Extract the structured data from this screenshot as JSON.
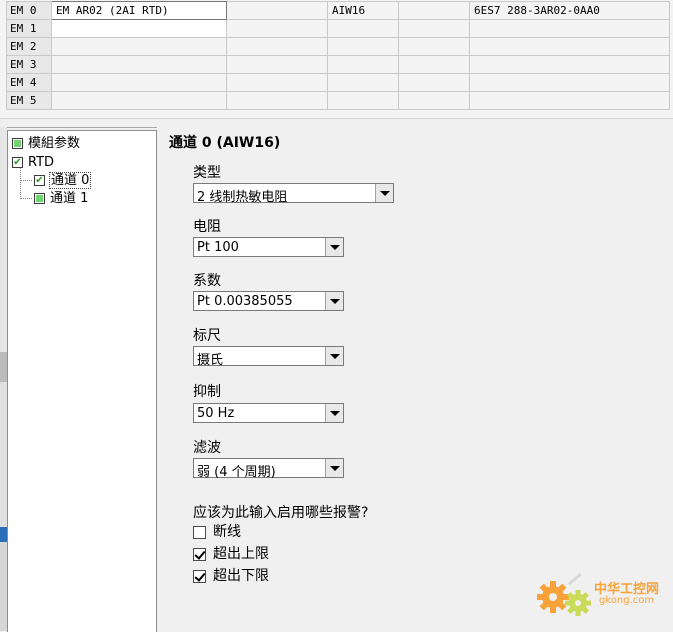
{
  "module_table": {
    "rows": [
      {
        "slot": "EM 0",
        "module": "EM AR02 (2AI RTD)",
        "col2": "",
        "address": "AIW16",
        "col4": "",
        "order_number": "6ES7 288-3AR02-0AA0"
      },
      {
        "slot": "EM 1",
        "module": "",
        "col2": "",
        "address": "",
        "col4": "",
        "order_number": ""
      },
      {
        "slot": "EM 2",
        "module": "",
        "col2": "",
        "address": "",
        "col4": "",
        "order_number": ""
      },
      {
        "slot": "EM 3",
        "module": "",
        "col2": "",
        "address": "",
        "col4": "",
        "order_number": ""
      },
      {
        "slot": "EM 4",
        "module": "",
        "col2": "",
        "address": "",
        "col4": "",
        "order_number": ""
      },
      {
        "slot": "EM 5",
        "module": "",
        "col2": "",
        "address": "",
        "col4": "",
        "order_number": ""
      }
    ]
  },
  "tree": {
    "items": [
      {
        "label": "模組参数"
      },
      {
        "label": "RTD"
      },
      {
        "label": "通道 0"
      },
      {
        "label": "通道 1"
      }
    ]
  },
  "channel": {
    "title": "通道 0 (AIW16)",
    "fields": [
      {
        "label": "类型",
        "value": "2 线制热敏电阻"
      },
      {
        "label": "电阻",
        "value": "Pt 100"
      },
      {
        "label": "系数",
        "value": "Pt 0.00385055"
      },
      {
        "label": "标尺",
        "value": "摄氏"
      },
      {
        "label": "抑制",
        "value": "50 Hz"
      },
      {
        "label": "滤波",
        "value": "弱 (4 个周期)"
      }
    ],
    "alarm_question": "应该为此输入启用哪些报警?",
    "alarms": [
      {
        "label": "断线",
        "checked": false
      },
      {
        "label": "超出上限",
        "checked": true
      },
      {
        "label": "超出下限",
        "checked": true
      }
    ]
  },
  "watermark": {
    "brand": "中华工控网",
    "site": "gkong.com"
  },
  "colors": {
    "tree_check_green": "#6fd36f",
    "watermark_orange": "#f7a33a"
  }
}
